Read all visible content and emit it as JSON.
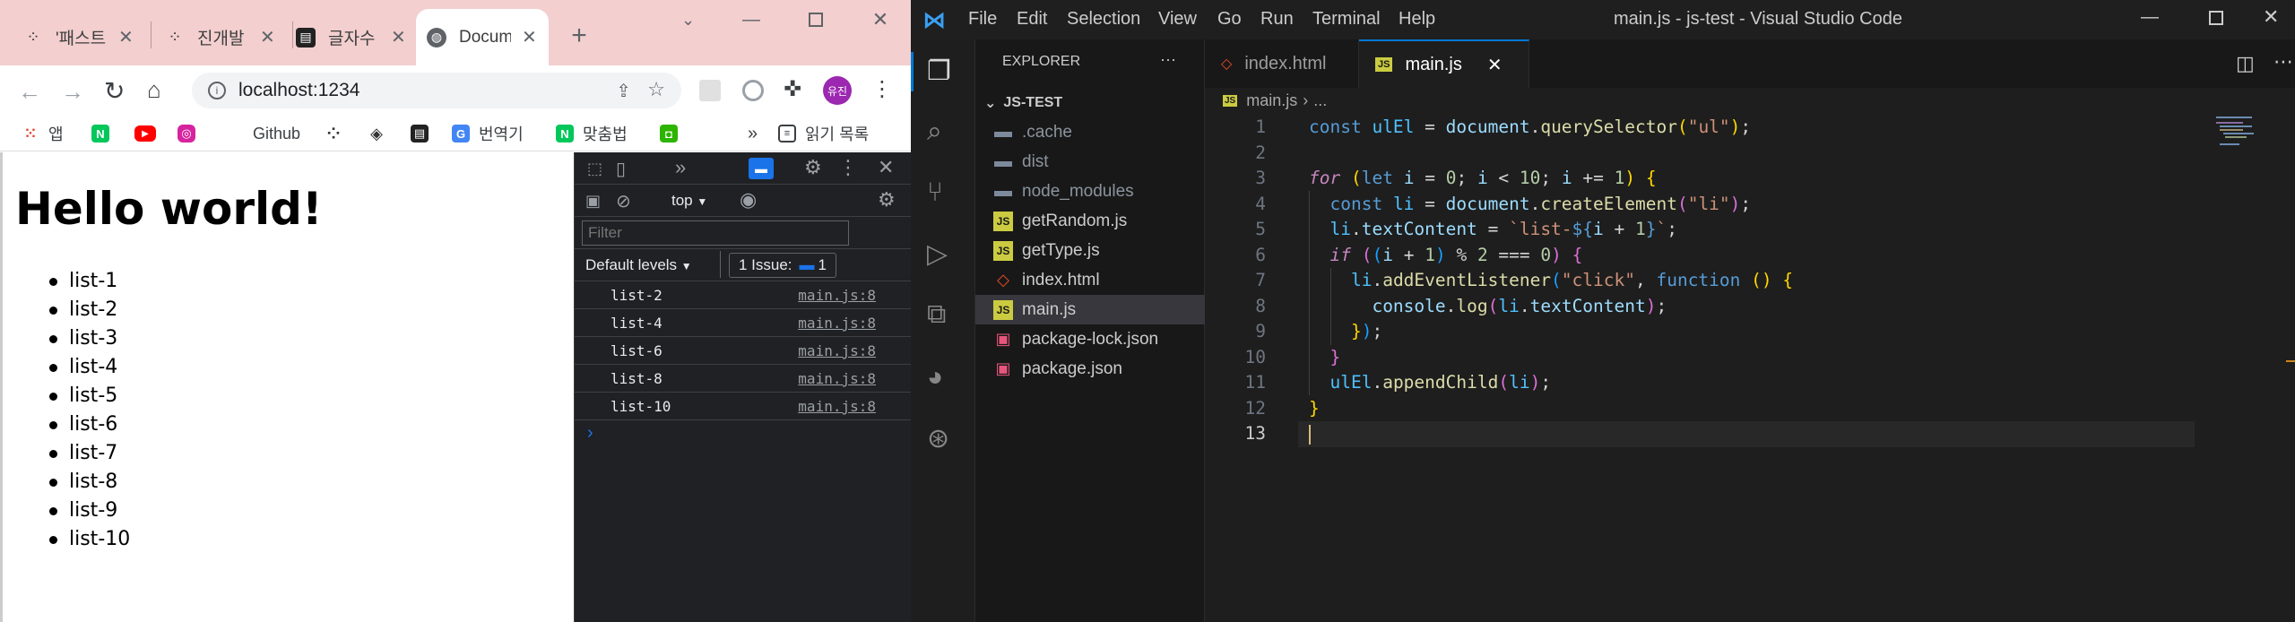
{
  "chrome": {
    "tabs": [
      {
        "title": "'패스트",
        "active": false
      },
      {
        "title": "진개발",
        "active": false
      },
      {
        "title": "글자수",
        "active": false
      },
      {
        "title": "Docum",
        "active": true
      }
    ],
    "new_tab": "+",
    "url": "localhost:1234",
    "profile_initials": "유진",
    "bookmarks": [
      {
        "label": "앱"
      },
      {
        "label": ""
      },
      {
        "label": ""
      },
      {
        "label": ""
      },
      {
        "label": "Github"
      },
      {
        "label": ""
      },
      {
        "label": ""
      },
      {
        "label": ""
      },
      {
        "label": "번역기"
      },
      {
        "label": "맞춤법"
      },
      {
        "label": ""
      }
    ],
    "bookmarks_more": "»",
    "reading_list": "읽기 목록",
    "page": {
      "heading": "Hello world!",
      "items": [
        "list-1",
        "list-2",
        "list-3",
        "list-4",
        "list-5",
        "list-6",
        "list-7",
        "list-8",
        "list-9",
        "list-10"
      ]
    },
    "devtools": {
      "context": "top",
      "filter_placeholder": "Filter",
      "levels": "Default levels",
      "issues_label": "1 Issue:",
      "issues_count": "1",
      "prompt": "›",
      "logs": [
        {
          "msg": "list-2",
          "src": "main.js:8"
        },
        {
          "msg": "list-4",
          "src": "main.js:8"
        },
        {
          "msg": "list-6",
          "src": "main.js:8"
        },
        {
          "msg": "list-8",
          "src": "main.js:8"
        },
        {
          "msg": "list-10",
          "src": "main.js:8"
        }
      ]
    }
  },
  "vscode": {
    "window_title": "main.js - js-test - Visual Studio Code",
    "menu": [
      "File",
      "Edit",
      "Selection",
      "View",
      "Go",
      "Run",
      "Terminal",
      "Help"
    ],
    "explorer_title": "EXPLORER",
    "explorer_more": "···",
    "project": "JS-TEST",
    "files": [
      {
        "name": ".cache",
        "type": "folder"
      },
      {
        "name": "dist",
        "type": "folder"
      },
      {
        "name": "node_modules",
        "type": "folder"
      },
      {
        "name": "getRandom.js",
        "type": "js"
      },
      {
        "name": "getType.js",
        "type": "js"
      },
      {
        "name": "index.html",
        "type": "html"
      },
      {
        "name": "main.js",
        "type": "js"
      },
      {
        "name": "package-lock.json",
        "type": "json"
      },
      {
        "name": "package.json",
        "type": "json"
      }
    ],
    "tabs": [
      {
        "label": "index.html",
        "active": false
      },
      {
        "label": "main.js",
        "active": true
      }
    ],
    "breadcrumb": [
      "main.js",
      "..."
    ],
    "line_numbers": [
      "1",
      "2",
      "3",
      "4",
      "5",
      "6",
      "7",
      "8",
      "9",
      "10",
      "11",
      "12",
      "13"
    ],
    "colors": {
      "accent": "#0078d4",
      "chrome_tabstrip": "#f3cfcf"
    }
  }
}
